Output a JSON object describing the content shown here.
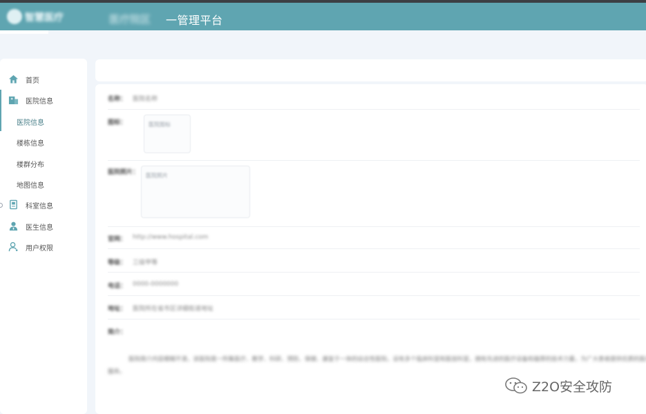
{
  "header": {
    "logo_text": "智慧医疗",
    "title_blurred": "医疗院区",
    "title": "一管理平台"
  },
  "sidebar": {
    "items": [
      {
        "label": "首页",
        "icon": "home-icon",
        "level": 1
      },
      {
        "label": "医院信息",
        "icon": "hospital-icon",
        "level": 1
      },
      {
        "label": "医院信息",
        "icon": "",
        "level": 2,
        "active": true
      },
      {
        "label": "楼栋信息",
        "icon": "",
        "level": 2
      },
      {
        "label": "楼群分布",
        "icon": "",
        "level": 2
      },
      {
        "label": "地图信息",
        "icon": "",
        "level": 2
      },
      {
        "label": "科室信息",
        "icon": "department-icon",
        "level": 1
      },
      {
        "label": "医生信息",
        "icon": "doctor-icon",
        "level": 1
      },
      {
        "label": "用户权限",
        "icon": "user-icon",
        "level": 1
      }
    ]
  },
  "detail": {
    "name_label": "名称：",
    "name_value": "医院名称",
    "logo_label": "图标：",
    "logo_alt": "医院图标",
    "photo_label": "医院照片：",
    "photo_alt": "医院照片",
    "website_label": "官网：",
    "website_value": "http://www.hospital.com",
    "level_label": "等级：",
    "level_value": "三级甲等",
    "phone_label": "电话：",
    "phone_value": "0000-0000000",
    "address_label": "地址：",
    "address_value": "医院所在省市区详细街道地址",
    "intro_label": "简介：",
    "intro_text": "医院简介内容模糊不清，该医院是一所集医疗、教学、科研、预防、保健、康复于一体的综合性医院，设有多个临床科室和医技科室，拥有先进的医疗设备和雄厚的技术力量，为广大患者提供优质的医疗服务。"
  },
  "watermark": {
    "text": "Z2O安全攻防"
  },
  "colors": {
    "header": "#5fa5b1",
    "accent": "#5fa5b1",
    "background": "#f1f5fa"
  }
}
